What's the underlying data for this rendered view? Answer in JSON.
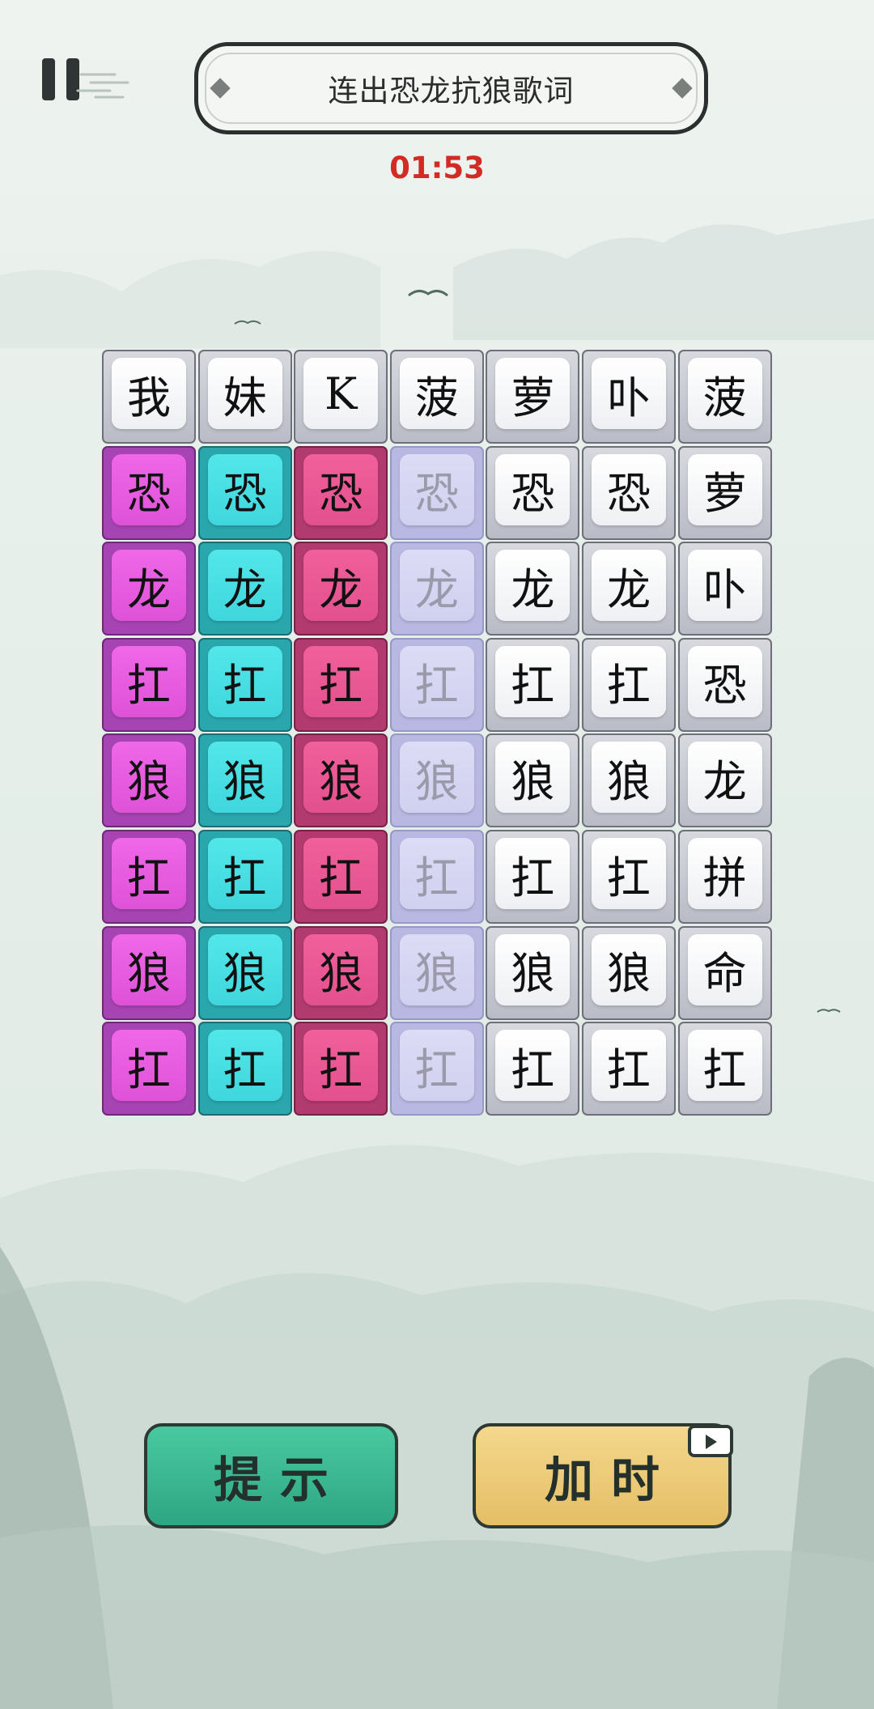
{
  "header": {
    "title": "连出恐龙抗狼歌词",
    "timer": "01:53"
  },
  "board": {
    "rows": [
      [
        {
          "ch": "我",
          "c": "w"
        },
        {
          "ch": "妹",
          "c": "w"
        },
        {
          "ch": "K",
          "c": "w"
        },
        {
          "ch": "菠",
          "c": "w"
        },
        {
          "ch": "萝",
          "c": "w"
        },
        {
          "ch": "卟",
          "c": "w"
        },
        {
          "ch": "菠",
          "c": "w"
        }
      ],
      [
        {
          "ch": "恐",
          "c": "magenta"
        },
        {
          "ch": "恐",
          "c": "cyan"
        },
        {
          "ch": "恐",
          "c": "pink"
        },
        {
          "ch": "恐",
          "c": "lav"
        },
        {
          "ch": "恐",
          "c": "w"
        },
        {
          "ch": "恐",
          "c": "w"
        },
        {
          "ch": "萝",
          "c": "w"
        }
      ],
      [
        {
          "ch": "龙",
          "c": "magenta"
        },
        {
          "ch": "龙",
          "c": "cyan"
        },
        {
          "ch": "龙",
          "c": "pink"
        },
        {
          "ch": "龙",
          "c": "lav"
        },
        {
          "ch": "龙",
          "c": "w"
        },
        {
          "ch": "龙",
          "c": "w"
        },
        {
          "ch": "卟",
          "c": "w"
        }
      ],
      [
        {
          "ch": "扛",
          "c": "magenta"
        },
        {
          "ch": "扛",
          "c": "cyan"
        },
        {
          "ch": "扛",
          "c": "pink"
        },
        {
          "ch": "扛",
          "c": "lav"
        },
        {
          "ch": "扛",
          "c": "w"
        },
        {
          "ch": "扛",
          "c": "w"
        },
        {
          "ch": "恐",
          "c": "w"
        }
      ],
      [
        {
          "ch": "狼",
          "c": "magenta"
        },
        {
          "ch": "狼",
          "c": "cyan"
        },
        {
          "ch": "狼",
          "c": "pink"
        },
        {
          "ch": "狼",
          "c": "lav"
        },
        {
          "ch": "狼",
          "c": "w"
        },
        {
          "ch": "狼",
          "c": "w"
        },
        {
          "ch": "龙",
          "c": "w"
        }
      ],
      [
        {
          "ch": "扛",
          "c": "magenta"
        },
        {
          "ch": "扛",
          "c": "cyan"
        },
        {
          "ch": "扛",
          "c": "pink"
        },
        {
          "ch": "扛",
          "c": "lav"
        },
        {
          "ch": "扛",
          "c": "w"
        },
        {
          "ch": "扛",
          "c": "w"
        },
        {
          "ch": "拼",
          "c": "w"
        }
      ],
      [
        {
          "ch": "狼",
          "c": "magenta"
        },
        {
          "ch": "狼",
          "c": "cyan"
        },
        {
          "ch": "狼",
          "c": "pink"
        },
        {
          "ch": "狼",
          "c": "lav"
        },
        {
          "ch": "狼",
          "c": "w"
        },
        {
          "ch": "狼",
          "c": "w"
        },
        {
          "ch": "命",
          "c": "w"
        }
      ],
      [
        {
          "ch": "扛",
          "c": "magenta"
        },
        {
          "ch": "扛",
          "c": "cyan"
        },
        {
          "ch": "扛",
          "c": "pink"
        },
        {
          "ch": "扛",
          "c": "lav"
        },
        {
          "ch": "扛",
          "c": "w"
        },
        {
          "ch": "扛",
          "c": "w"
        },
        {
          "ch": "扛",
          "c": "w"
        }
      ]
    ]
  },
  "buttons": {
    "hint": "提示",
    "add_time": "加时"
  },
  "icons": {
    "pause": "pause-icon",
    "video": "video-ad-icon"
  },
  "colors": {
    "timer": "#d22a24",
    "magenta": "#de52d8",
    "cyan": "#3fd6dd",
    "pink": "#e2508d",
    "lavender": "#d0d0f0",
    "hint_button": "#2ea683",
    "time_button": "#e5be66"
  }
}
